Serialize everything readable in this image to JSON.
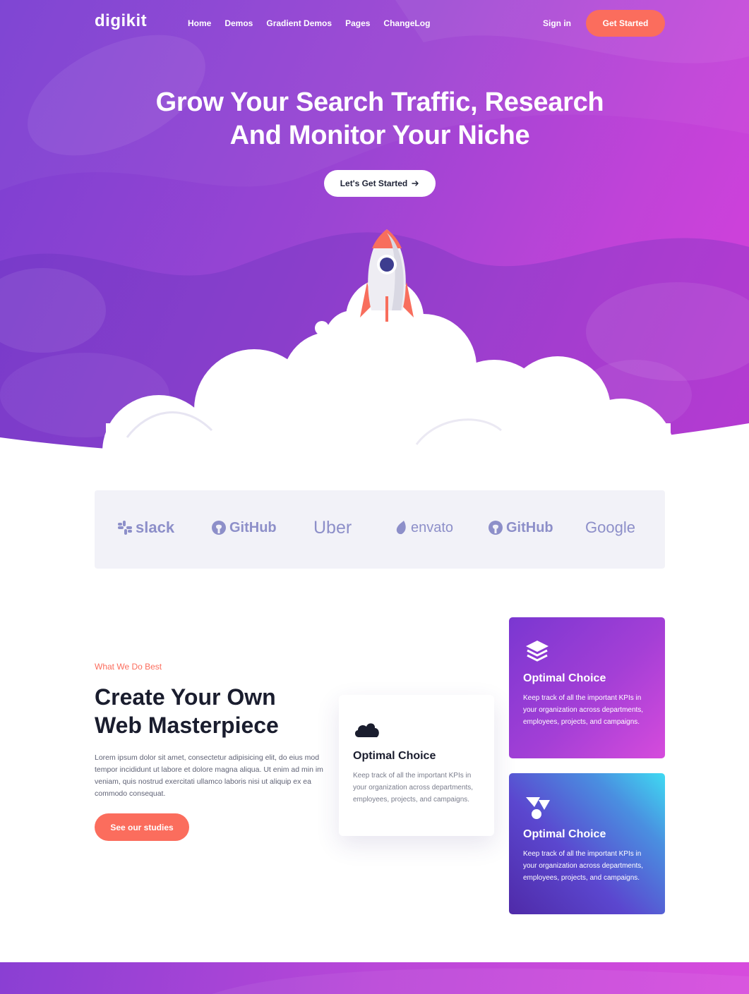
{
  "header": {
    "logo": "digikit",
    "nav": [
      "Home",
      "Demos",
      "Gradient Demos",
      "Pages",
      "ChangeLog"
    ],
    "signin": "Sign in",
    "cta": "Get Started"
  },
  "hero": {
    "title_line1": "Grow Your Search Traffic, Research",
    "title_line2": "And Monitor Your Niche",
    "button": "Let's Get Started",
    "button_icon": "arrow-right-icon"
  },
  "brands": [
    "slack",
    "GitHub",
    "Uber",
    "envato",
    "GitHub",
    "Google"
  ],
  "services": {
    "eyebrow": "What We Do Best",
    "title_line1": "Create Your Own",
    "title_line2": "Web Masterpiece",
    "text": "Lorem ipsum dolor sit amet, consectetur adipisicing elit, do eius mod tempor incididunt ut labore et dolore magna aliqua. Ut enim ad min im veniam, quis nostrud exercitati ullamco laboris nisi ut aliquip ex ea commodo consequat.",
    "button": "See our studies",
    "cards": [
      {
        "icon": "cloud-icon",
        "title": "Optimal Choice",
        "text": "Keep track of all the important KPIs in your organization across departments, employees, projects, and campaigns."
      },
      {
        "icon": "layers-icon",
        "title": "Optimal Choice",
        "text": "Keep track of all the important KPIs in your organization across departments, employees, projects, and campaigns."
      },
      {
        "icon": "shapes-icon",
        "title": "Optimal Choice",
        "text": "Keep track of all the important KPIs in your organization across departments, employees, projects, and campaigns."
      }
    ]
  },
  "colors": {
    "accent": "#fb6d5d",
    "hero_start": "#7a3fd2",
    "hero_end": "#d83fdc",
    "brand_logo": "#8d8fc9"
  }
}
